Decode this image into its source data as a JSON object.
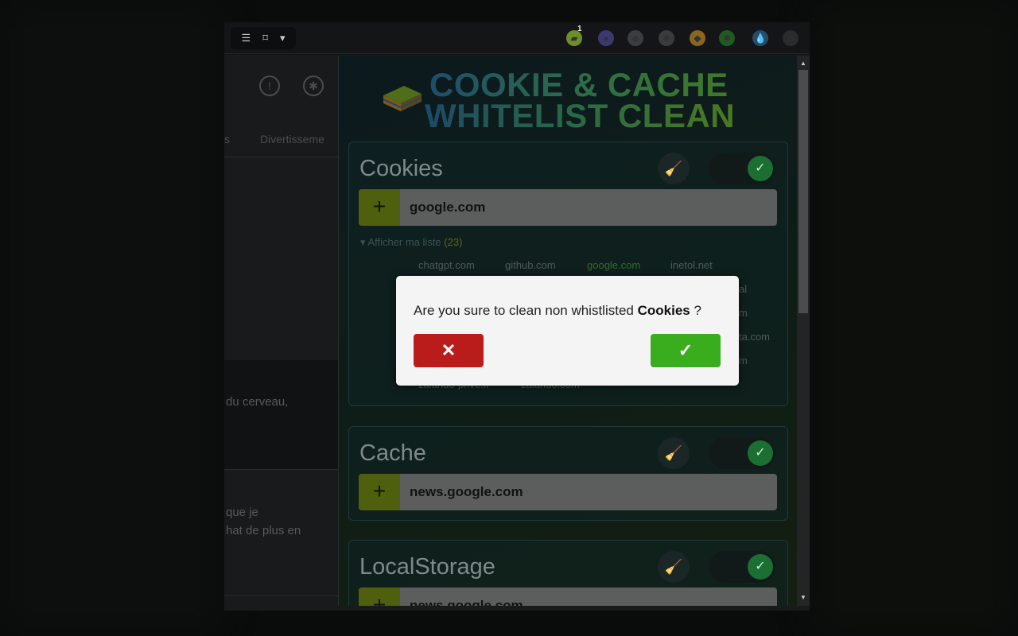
{
  "toolbar": {
    "reader_icon": "reader-mode-icon",
    "bookmark_icon": "bookmark-icon",
    "menu_icon": "chevron-down-icon",
    "extensions": [
      {
        "name": "cookie-cache-extension-icon",
        "color": "#6d8f2a",
        "glyph": "▰"
      },
      {
        "name": "purple-extension-icon",
        "color": "#3b3970",
        "glyph": "●"
      },
      {
        "name": "shield-extension-icon",
        "color": "#3c3d40",
        "glyph": "◆"
      },
      {
        "name": "gear-extension-icon",
        "color": "#3a3b3c",
        "glyph": "✱"
      },
      {
        "name": "orange-extension-icon",
        "color": "#8a6620",
        "glyph": "◆"
      },
      {
        "name": "green-extension-icon",
        "color": "#1f5a22",
        "glyph": "✹"
      },
      {
        "name": "drop-extension-icon",
        "color": "#2a4a6a",
        "glyph": "💧"
      },
      {
        "name": "puzzle-extension-icon",
        "color": "#2a2b2c",
        "glyph": "‹›"
      }
    ],
    "badge_count": "1"
  },
  "background_page": {
    "nav_partial_1": "s",
    "nav_partial_2": "Divertisseme",
    "text_1": "du cerveau,",
    "text_2_line1": "que je",
    "text_2_line2": "hat de plus en"
  },
  "popup": {
    "title_line1": "COOKIE & CACHE",
    "title_line2": "WHITELIST CLEAN",
    "sections": [
      {
        "title": "Cookies",
        "input_value": "google.com",
        "list_label": "▾ Afficher ma liste",
        "list_count": "(23)",
        "domains": [
          {
            "name": "chatgpt.com",
            "active": false
          },
          {
            "name": "github.com",
            "active": false
          },
          {
            "name": "google.com",
            "active": true
          },
          {
            "name": "inetol.net",
            "active": false
          },
          {
            "name": "al",
            "active": false
          },
          {
            "name": "m",
            "active": false
          },
          {
            "name": "ta.com",
            "active": false
          },
          {
            "name": "m",
            "active": false
          },
          {
            "name": "zalando-prive.fr",
            "active": false
          },
          {
            "name": "zalando.com",
            "active": false
          }
        ]
      },
      {
        "title": "Cache",
        "input_value": "news.google.com"
      },
      {
        "title": "LocalStorage",
        "input_value": "news.google.com"
      }
    ]
  },
  "modal": {
    "message_prefix": "Are you sure to clean non whistlisted",
    "message_target": "Cookies",
    "message_suffix": "?",
    "cancel_icon": "close-icon",
    "confirm_icon": "check-icon"
  }
}
